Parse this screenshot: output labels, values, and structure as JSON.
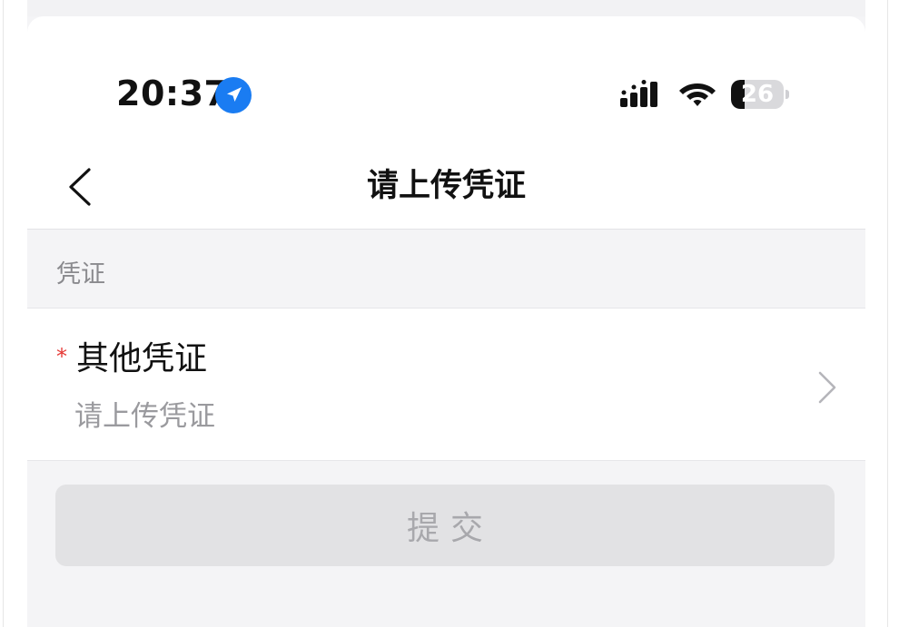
{
  "status_bar": {
    "time": "20:37",
    "battery_level": "26",
    "location_icon": "location-arrow-icon",
    "signal_icon": "cellular-signal-icon",
    "wifi_icon": "wifi-icon",
    "battery_icon": "battery-icon"
  },
  "nav": {
    "title": "请上传凭证",
    "back_icon": "chevron-left-icon"
  },
  "section": {
    "label": "凭证"
  },
  "upload_row": {
    "required_mark": "*",
    "title": "其他凭证",
    "subtitle": "请上传凭证",
    "chevron_icon": "chevron-right-icon"
  },
  "submit": {
    "label": "提交"
  },
  "colors": {
    "background": "#f4f4f6",
    "card": "#ffffff",
    "required": "#e53935",
    "location_blue": "#1a7cf2",
    "button_disabled_bg": "#e2e2e4",
    "button_disabled_text": "#a8a8ac"
  }
}
